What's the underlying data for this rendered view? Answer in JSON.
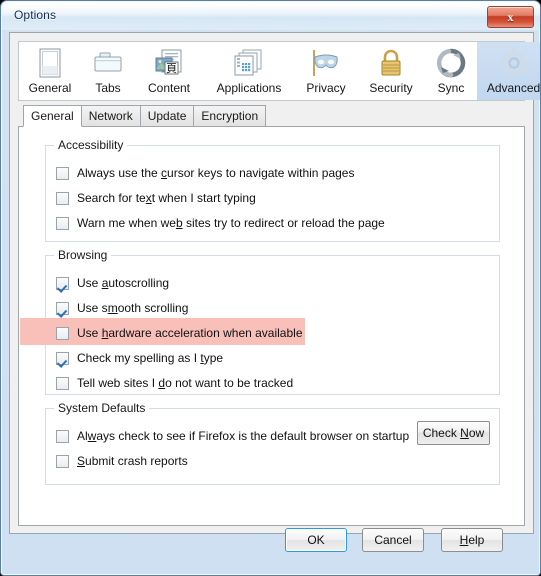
{
  "window": {
    "title": "Options",
    "close_label": "x",
    "close_icon": "close-icon"
  },
  "icon_tabs": [
    {
      "label": "General",
      "icon": "document-page-icon",
      "selected": false,
      "width": 62
    },
    {
      "label": "Tabs",
      "icon": "folder-tabs-icon",
      "selected": false,
      "width": 54
    },
    {
      "label": "Content",
      "icon": "content-page-icon",
      "selected": false,
      "width": 68
    },
    {
      "label": "Applications",
      "icon": "applications-icon",
      "selected": false,
      "width": 92
    },
    {
      "label": "Privacy",
      "icon": "privacy-mask-icon",
      "selected": false,
      "width": 62
    },
    {
      "label": "Security",
      "icon": "security-lock-icon",
      "selected": false,
      "width": 68
    },
    {
      "label": "Sync",
      "icon": "sync-arrows-icon",
      "selected": false,
      "width": 52
    },
    {
      "label": "Advanced",
      "icon": "advanced-gear-icon",
      "selected": true,
      "width": 73
    }
  ],
  "sub_tabs": [
    {
      "label": "General",
      "active": true
    },
    {
      "label": "Network",
      "active": false
    },
    {
      "label": "Update",
      "active": false
    },
    {
      "label": "Encryption",
      "active": false
    }
  ],
  "groups": [
    {
      "legend": "Accessibility",
      "items": [
        {
          "pre": "Always use the ",
          "key": "c",
          "post": "ursor keys to navigate within pages",
          "checked": false,
          "highlighted": false
        },
        {
          "pre": "Search for te",
          "key": "x",
          "post": "t when I start typing",
          "checked": false,
          "highlighted": false
        },
        {
          "pre": "Warn me when we",
          "key": "b",
          "post": " sites try to redirect or reload the page",
          "checked": false,
          "highlighted": false
        }
      ]
    },
    {
      "legend": "Browsing",
      "items": [
        {
          "pre": "Use ",
          "key": "a",
          "post": "utoscrolling",
          "checked": true,
          "highlighted": false
        },
        {
          "pre": "Use s",
          "key": "m",
          "post": "ooth scrolling",
          "checked": true,
          "highlighted": false
        },
        {
          "pre": "Use ",
          "key": "h",
          "post": "ardware acceleration when available",
          "checked": false,
          "highlighted": true
        },
        {
          "pre": "Check my spelling as I ",
          "key": "t",
          "post": "ype",
          "checked": true,
          "highlighted": false
        },
        {
          "pre": "Tell web sites I ",
          "key": "d",
          "post": "o not want to be tracked",
          "checked": false,
          "highlighted": false
        }
      ]
    },
    {
      "legend": "System Defaults",
      "items": [
        {
          "pre": "Al",
          "key": "w",
          "post": "ays check to see if Firefox is the default browser on startup",
          "checked": false,
          "highlighted": false
        },
        {
          "pre": "",
          "key": "S",
          "post": "ubmit crash reports",
          "checked": false,
          "highlighted": false
        }
      ]
    }
  ],
  "check_now_button": {
    "pre": "Check ",
    "key": "N",
    "post": "ow"
  },
  "dialog_buttons": [
    {
      "pre": "OK",
      "key": "",
      "post": "",
      "default": true
    },
    {
      "pre": "Cancel",
      "key": "",
      "post": "",
      "default": false
    },
    {
      "pre": "",
      "key": "H",
      "post": "elp",
      "default": false
    }
  ],
  "colors": {
    "highlight": "#f9c0ba",
    "selected_tab": "#c8dbf0",
    "focus_border": "#2e9adf",
    "check_mark": "#2c6fb5",
    "close_button": "#c43d22"
  }
}
